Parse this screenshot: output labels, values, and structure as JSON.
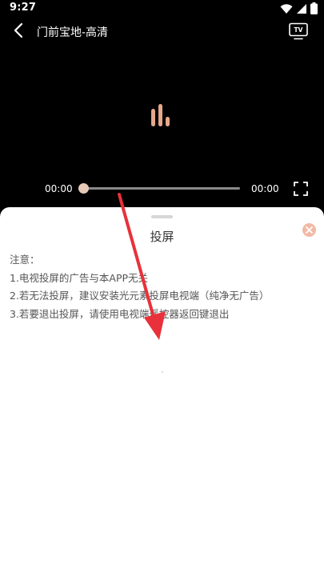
{
  "status_bar": {
    "time": "9:27"
  },
  "header": {
    "title": "门前宝地-高清",
    "tv_icon_text": "TV"
  },
  "player": {
    "current_time": "00:00",
    "total_time": "00:00",
    "progress": 0
  },
  "sheet": {
    "title": "投屏",
    "notice": [
      "注意：",
      "1.电视投屏的广告与本APP无关",
      "2.若无法投屏，建议安装光元素投屏电视端（纯净无广告）",
      "3.若要退出投屏，请使用电视端遥控器返回键退出"
    ]
  },
  "colors": {
    "accent": "#e6a88a",
    "close_button": "#f2b9a4",
    "annotation_arrow": "#e8313a"
  }
}
